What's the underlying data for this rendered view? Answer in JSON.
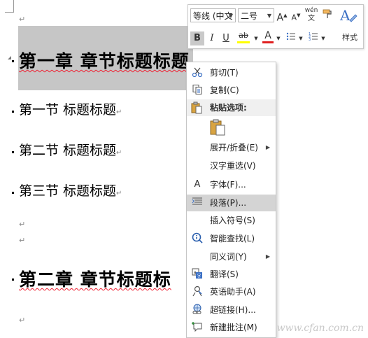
{
  "document": {
    "para_mark": "↵",
    "chapter1": "第一章  章节标题标题",
    "section1": "第一节  标题标题",
    "section2": "第二节  标题标题",
    "section3": "第三节  标题标题",
    "chapter2": "第二章  章节标题标"
  },
  "mini_toolbar": {
    "font_name": "等线 (中文",
    "font_size": "二号",
    "grow_font": "A",
    "shrink_font": "A",
    "phonetic": "wén",
    "bold": "B",
    "italic": "I",
    "underline": "U",
    "highlight": "ab",
    "font_color": "A",
    "styles_label": "样式"
  },
  "context_menu": {
    "items": [
      {
        "label": "剪切(T)",
        "icon": "scissors-icon"
      },
      {
        "label": "复制(C)",
        "icon": "copy-icon"
      },
      {
        "label": "粘贴选项:",
        "icon": "paste-icon"
      },
      {
        "label": "展开/折叠(E)",
        "icon": "",
        "submenu": true
      },
      {
        "label": "汉字重选(V)",
        "icon": ""
      },
      {
        "label": "字体(F)...",
        "icon": "font-icon"
      },
      {
        "label": "段落(P)...",
        "icon": "paragraph-icon",
        "highlighted": true
      },
      {
        "label": "插入符号(S)",
        "icon": ""
      },
      {
        "label": "智能查找(L)",
        "icon": "smart-lookup-icon"
      },
      {
        "label": "同义词(Y)",
        "icon": "",
        "submenu": true
      },
      {
        "label": "翻译(S)",
        "icon": "translate-icon"
      },
      {
        "label": "英语助手(A)",
        "icon": "english-assistant-icon"
      },
      {
        "label": "超链接(H)...",
        "icon": "hyperlink-icon"
      },
      {
        "label": "新建批注(M)",
        "icon": "new-comment-icon"
      }
    ]
  },
  "watermark": "www.cfan.com.cn",
  "colors": {
    "selection": "#c6c6c6",
    "highlight_yellow": "#ffff00",
    "font_red": "#e02020",
    "menu_highlight": "#d4d4d4"
  }
}
